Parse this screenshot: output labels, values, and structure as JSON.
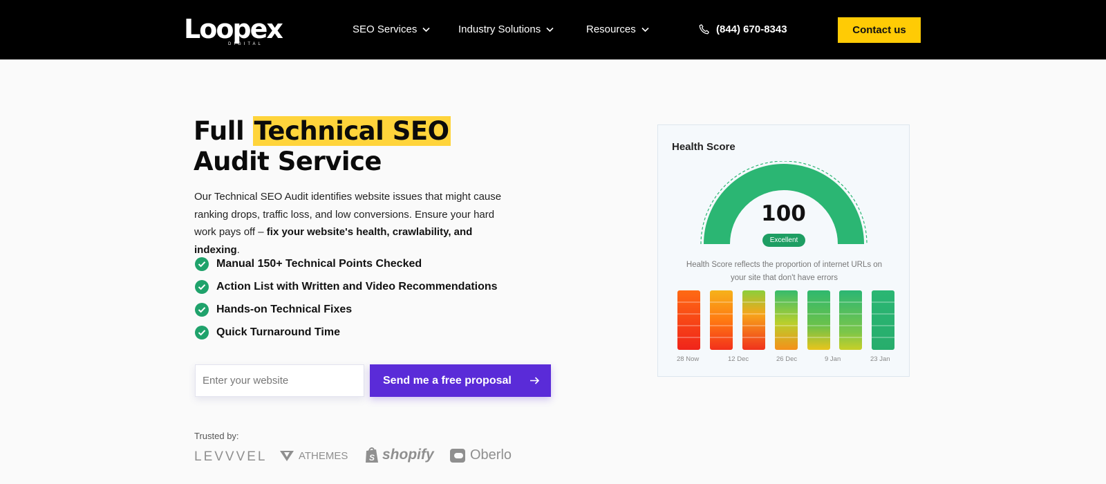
{
  "header": {
    "logo": {
      "word": "Loopex",
      "sub": "DIGITAL"
    },
    "nav": [
      {
        "label": "SEO Services"
      },
      {
        "label": "Industry Solutions"
      },
      {
        "label": "Resources"
      }
    ],
    "phone": "(844) 670-8343",
    "contact_label": "Contact us"
  },
  "hero": {
    "title_pre": "Full ",
    "title_highlight": "Technical SEO",
    "title_line2": "Audit Service",
    "desc_plain": "Our Technical SEO Audit identifies website issues that might cause ranking drops, traffic loss, and low conversions. Ensure your hard work pays off – ",
    "desc_bold": "fix your website's health, crawlability, and indexing",
    "desc_end": ".",
    "checks": [
      "Manual 150+ Technical Points Checked",
      "Action List with Written and Video Recommendations",
      "Hands-on Technical Fixes",
      "Quick Turnaround Time"
    ],
    "input_placeholder": "Enter your website",
    "cta_label": "Send me a free proposal",
    "trusted_label": "Trusted by:",
    "brands": [
      "LEVVVEL",
      "ATHEMES",
      "shopify",
      "Oberlo"
    ]
  },
  "health_card": {
    "title": "Health Score",
    "score": "100",
    "badge": "Excellent",
    "note": "Health Score reflects the proportion of internet URLs on your site that don't have errors",
    "gauge_value": 1.0,
    "dates": [
      "28 Now",
      "12 Dec",
      "26 Dec",
      "9 Jan",
      "23 Jan"
    ]
  },
  "colors": {
    "accent_yellow": "#ffcb05",
    "highlight": "#ffd43b",
    "cta_purple": "#5a2bd8",
    "check_green": "#1fa26b",
    "gauge_green": "#2bb673"
  }
}
